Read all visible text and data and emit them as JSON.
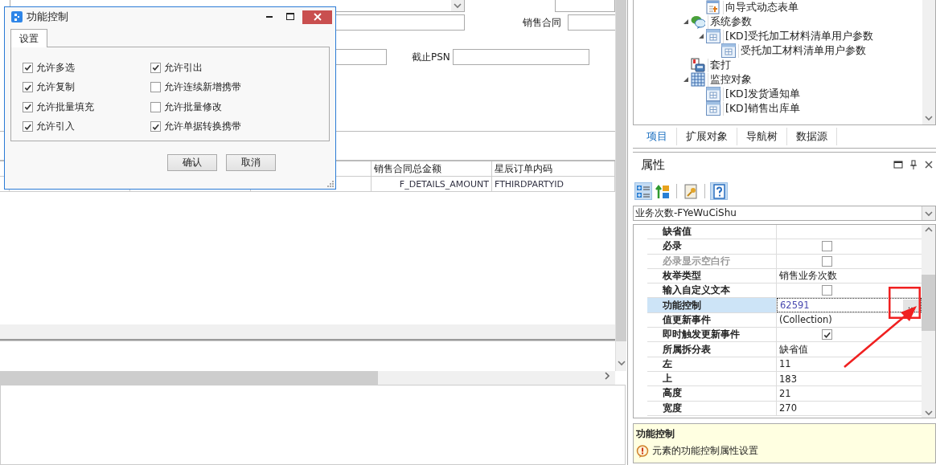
{
  "form": {
    "fields": [
      {
        "kind": "combo"
      }
    ],
    "labels": [
      "销售合同",
      "截止PSN"
    ]
  },
  "table": {
    "columns": [
      {
        "label": "销售合同总金额"
      },
      {
        "label": "星辰订单内码"
      }
    ],
    "rows": [
      [
        "F_DETAILS_AMOUNT",
        "FTHIRDPARTYID"
      ]
    ]
  },
  "dialog": {
    "title": "功能控制",
    "tabs": [
      {
        "label": "设置",
        "selected": true
      }
    ],
    "options": [
      {
        "label": "允许多选",
        "checked": true
      },
      {
        "label": "允许引出",
        "checked": true
      },
      {
        "label": "允许复制",
        "checked": true
      },
      {
        "label": "允许连续新增携带",
        "checked": false
      },
      {
        "label": "允许批量填充",
        "checked": true
      },
      {
        "label": "允许批量修改",
        "checked": false
      },
      {
        "label": "允许引入",
        "checked": true
      },
      {
        "label": "允许单据转换携带",
        "checked": true
      }
    ],
    "buttons": [
      "确认",
      "取消"
    ]
  },
  "tree": {
    "continued_children": [
      {
        "label": "向导式动态表单",
        "kind": "wizard"
      }
    ],
    "items": [
      {
        "label": "系统参数",
        "kind": "chat",
        "expanded": true,
        "children": [
          {
            "label": "[KD]受托加工材料清单用户参数",
            "kind": "table",
            "expanded": true,
            "children": [
              {
                "label": "受托加工材料清单用户参数",
                "kind": "table"
              }
            ]
          }
        ]
      },
      {
        "label": "套打",
        "kind": "print"
      },
      {
        "label": "监控对象",
        "kind": "grid",
        "expanded": true,
        "children": [
          {
            "label": "[KD]发货通知单",
            "kind": "table"
          },
          {
            "label": "[KD]销售出库单",
            "kind": "table"
          }
        ]
      }
    ]
  },
  "panel_tabs": [
    {
      "label": "项目",
      "selected": true
    },
    {
      "label": "扩展对象",
      "selected": false
    },
    {
      "label": "导航树",
      "selected": false
    },
    {
      "label": "数据源",
      "selected": false
    }
  ],
  "properties": {
    "title": "属性",
    "toolbar": [
      {
        "kind": "categorized",
        "selected": true
      },
      {
        "kind": "alphabetical",
        "selected": false
      },
      {
        "kind": "pages",
        "selected": false
      },
      {
        "kind": "help",
        "selected": true
      }
    ],
    "object": "业务次数-FYeWuCiShu",
    "rows": [
      {
        "name": "缺省值",
        "kind": "text",
        "selected": false,
        "disabled": false
      },
      {
        "name": "必录",
        "kind": "checkbox",
        "checked": false,
        "selected": false,
        "disabled": false
      },
      {
        "name": "必录显示空白行",
        "kind": "checkbox",
        "checked": false,
        "selected": false,
        "disabled": true
      },
      {
        "name": "枚举类型",
        "kind": "text",
        "value": "销售业务次数",
        "selected": false,
        "disabled": false
      },
      {
        "name": "输入自定义文本",
        "kind": "checkbox",
        "checked": false,
        "selected": false,
        "disabled": false
      },
      {
        "name": "功能控制",
        "kind": "text",
        "value": "62591",
        "action": "...",
        "selected": true,
        "disabled": false
      },
      {
        "name": "值更新事件",
        "kind": "text",
        "value": "(Collection)",
        "selected": false,
        "disabled": false
      },
      {
        "name": "即时触发更新事件",
        "kind": "checkbox",
        "checked": true,
        "selected": false,
        "disabled": false
      },
      {
        "name": "所属拆分表",
        "kind": "text",
        "value": "缺省值",
        "selected": false,
        "disabled": false
      },
      {
        "name": "左",
        "kind": "text",
        "value": "11",
        "selected": false,
        "disabled": false
      },
      {
        "name": "上",
        "kind": "text",
        "value": "183",
        "selected": false,
        "disabled": false
      },
      {
        "name": "高度",
        "kind": "text",
        "value": "21",
        "selected": false,
        "disabled": false
      },
      {
        "name": "宽度",
        "kind": "text",
        "value": "270",
        "selected": false,
        "disabled": false
      }
    ],
    "description": {
      "title": "功能控制",
      "text": "元素的功能控制属性设置"
    }
  }
}
